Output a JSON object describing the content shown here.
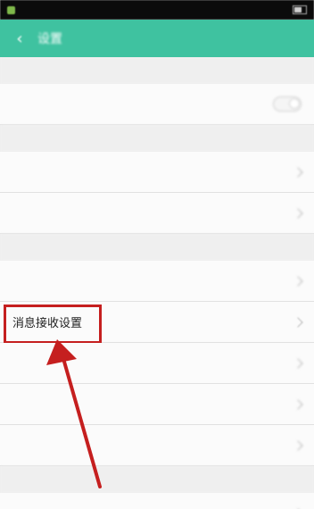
{
  "title_bar": {
    "back_glyph": "‹",
    "title": "设置"
  },
  "status_bar": {
    "left_text": "",
    "right_text": ""
  },
  "rows": {
    "highlight_label": "消息接收设置"
  },
  "annotation": {
    "box_color": "#c51f1f",
    "arrow_color": "#c51f1f"
  },
  "colors": {
    "accent": "#3fc2a0",
    "status_bar": "#0b0b0b",
    "row_bg": "#fbfbfb",
    "page_bg": "#efefef"
  },
  "icons": {
    "back": "back-arrow-icon",
    "chevron": "chevron-right-icon",
    "toggle": "toggle-switch-icon"
  }
}
